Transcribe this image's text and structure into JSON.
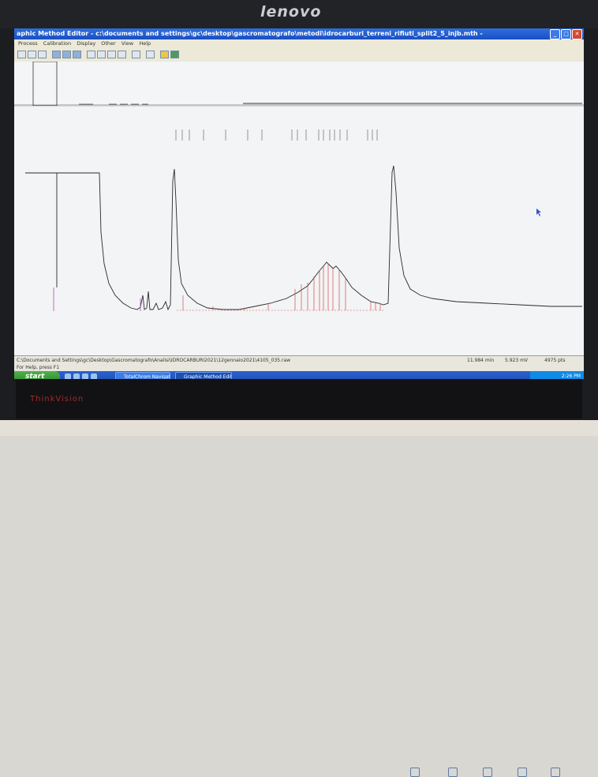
{
  "monitor": {
    "brand": "lenovo",
    "model_label": "ThinkVision"
  },
  "window": {
    "title": "aphic Method Editor  - c:\\documents and settings\\gc\\desktop\\gascromatografo\\metodi\\idrocarburi_terreni_rifiuti_split2_5_injb.mth -",
    "minimize": "_",
    "maximize": "□",
    "close": "✕"
  },
  "menu": [
    "Process",
    "Calibration",
    "Display",
    "Other",
    "View",
    "Help"
  ],
  "chromatogram": {
    "trace_color": "#2a2a2a",
    "marker_color": "#d94a4a",
    "baseline_label_color": "#b04fb0"
  },
  "status": {
    "path": "C:\\Documents and Settings\\gc\\Desktop\\Gascromatografo\\Analisi\\IDROCARBURI2021\\12gennaio2021\\4105_035.raw",
    "time": "11.984 min",
    "signal": "5.923 mV",
    "points": "4975 pts"
  },
  "hint": "For Help, press F1",
  "taskbar": {
    "start": "start",
    "tasks": [
      "TotalChrom Navigato...",
      "Graphic Method Edito..."
    ],
    "clock": "2:26 PM"
  }
}
